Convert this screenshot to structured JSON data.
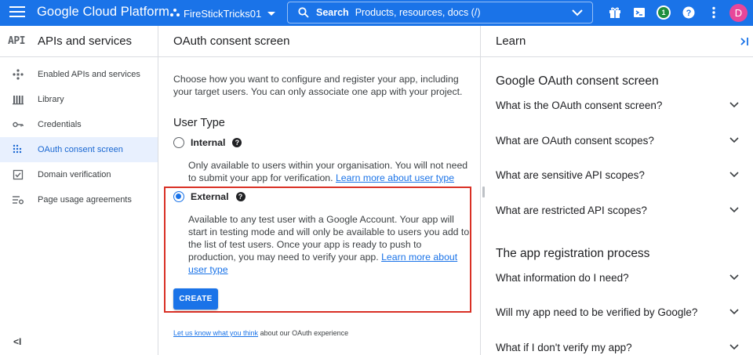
{
  "topbar": {
    "brand": "Google Cloud Platform",
    "project": "FireStickTricks01",
    "search_label": "Search",
    "search_placeholder": "Products, resources, docs (/)",
    "notification_count": "1",
    "avatar_initial": "D",
    "brand_color": "#1a73e8"
  },
  "sidebar": {
    "logo": "API",
    "title": "APIs and services",
    "items": [
      {
        "label": "Enabled APIs and services",
        "icon": "diamond-nodes-icon"
      },
      {
        "label": "Library",
        "icon": "library-icon"
      },
      {
        "label": "Credentials",
        "icon": "key-icon"
      },
      {
        "label": "OAuth consent screen",
        "icon": "consent-icon",
        "active": true
      },
      {
        "label": "Domain verification",
        "icon": "checkbox-icon"
      },
      {
        "label": "Page usage agreements",
        "icon": "settings-list-icon"
      }
    ],
    "collapse_glyph": "<I"
  },
  "main": {
    "title": "OAuth consent screen",
    "intro": "Choose how you want to configure and register your app, including your target users. You can only associate one app with your project.",
    "user_type_title": "User Type",
    "internal": {
      "label": "Internal",
      "desc": "Only available to users within your organisation. You will not need to submit your app for verification.",
      "link": "Learn more about user type"
    },
    "external": {
      "label": "External",
      "selected": true,
      "desc": "Available to any test user with a Google Account. Your app will start in testing mode and will only be available to users you add to the list of test users. Once your app is ready to push to production, you may need to verify your app.",
      "link": "Learn more about user type"
    },
    "create_label": "CREATE",
    "feedback_link": "Let us know what you think",
    "feedback_text": "about our OAuth experience"
  },
  "learn": {
    "title": "Learn",
    "section1": "Google OAuth consent screen",
    "faq1": [
      "What is the OAuth consent screen?",
      "What are OAuth consent scopes?",
      "What are sensitive API scopes?",
      "What are restricted API scopes?"
    ],
    "section2": "The app registration process",
    "faq2": [
      "What information do I need?",
      "Will my app need to be verified by Google?",
      "What if I don't verify my app?"
    ]
  }
}
